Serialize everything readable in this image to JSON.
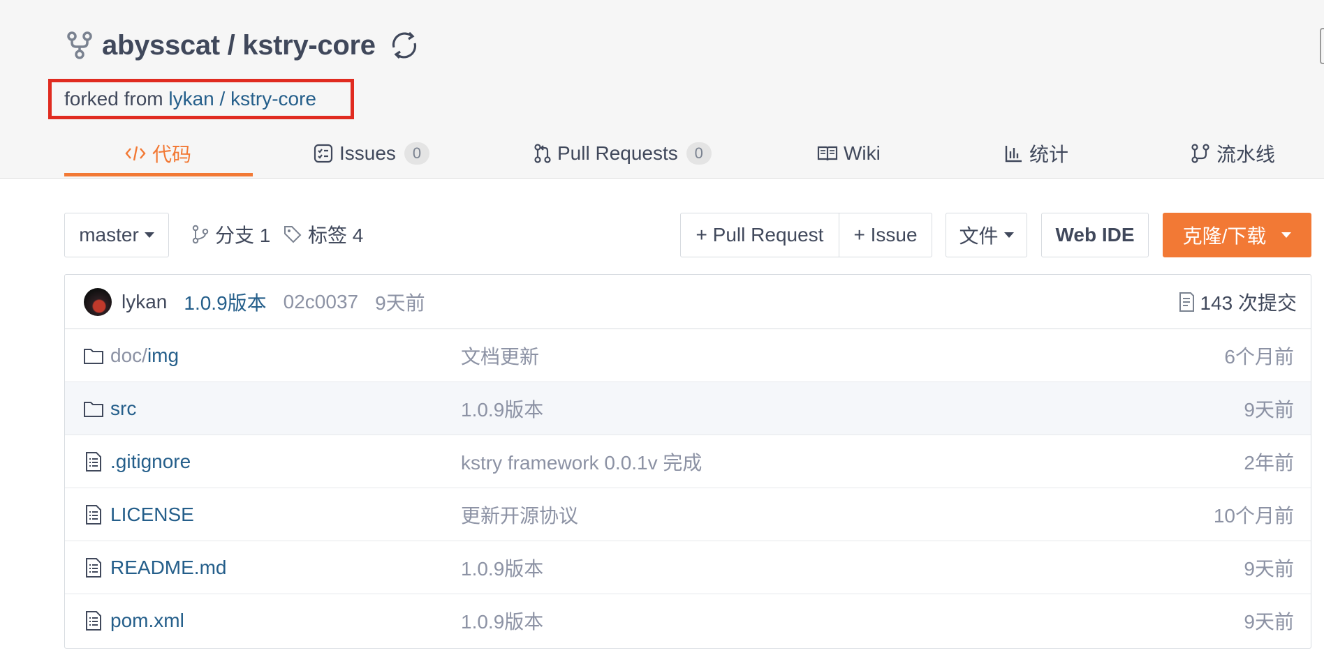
{
  "repo": {
    "owner": "abysscat",
    "name": "kstry-core",
    "title": "abysscat / kstry-core",
    "forked_prefix": "forked from ",
    "forked_owner": "lykan",
    "forked_sep": " / ",
    "forked_repo": "kstry-core"
  },
  "tabs": [
    {
      "label": "代码",
      "icon": "code-icon",
      "active": true
    },
    {
      "label": "Issues",
      "badge": "0",
      "icon": "issues-icon"
    },
    {
      "label": "Pull Requests",
      "badge": "0",
      "icon": "pull-request-icon"
    },
    {
      "label": "Wiki",
      "icon": "wiki-book-icon"
    },
    {
      "label": "统计",
      "icon": "stats-chart-icon"
    },
    {
      "label": "流水线",
      "icon": "pipeline-icon"
    }
  ],
  "toolbar": {
    "branch": "master",
    "branches_label": "分支 1",
    "tags_label": "标签 4",
    "new_pr": "+ Pull Request",
    "new_issue": "+ Issue",
    "files": "文件",
    "web_ide": "Web IDE",
    "clone": "克隆/下载"
  },
  "commit": {
    "author": "lykan",
    "message": "1.0.9版本",
    "sha": "02c0037",
    "time": "9天前",
    "count": "143 次提交"
  },
  "files": [
    {
      "type": "folder",
      "name_dim": "doc/",
      "name": "img",
      "message": "文档更新",
      "time": "6个月前"
    },
    {
      "type": "folder",
      "name_dim": "",
      "name": "src",
      "message": "1.0.9版本",
      "time": "9天前"
    },
    {
      "type": "file",
      "name_dim": "",
      "name": ".gitignore",
      "message": "kstry framework 0.0.1v 完成",
      "time": "2年前"
    },
    {
      "type": "file",
      "name_dim": "",
      "name": "LICENSE",
      "message": "更新开源协议",
      "time": "10个月前"
    },
    {
      "type": "file",
      "name_dim": "",
      "name": "README.md",
      "message": "1.0.9版本",
      "time": "9天前"
    },
    {
      "type": "file",
      "name_dim": "",
      "name": "pom.xml",
      "message": "1.0.9版本",
      "time": "9天前"
    }
  ],
  "colors": {
    "accent": "#f27935",
    "link": "#245e8a",
    "highlight_box": "#e02b20",
    "header_bg": "#f6f6f6"
  }
}
